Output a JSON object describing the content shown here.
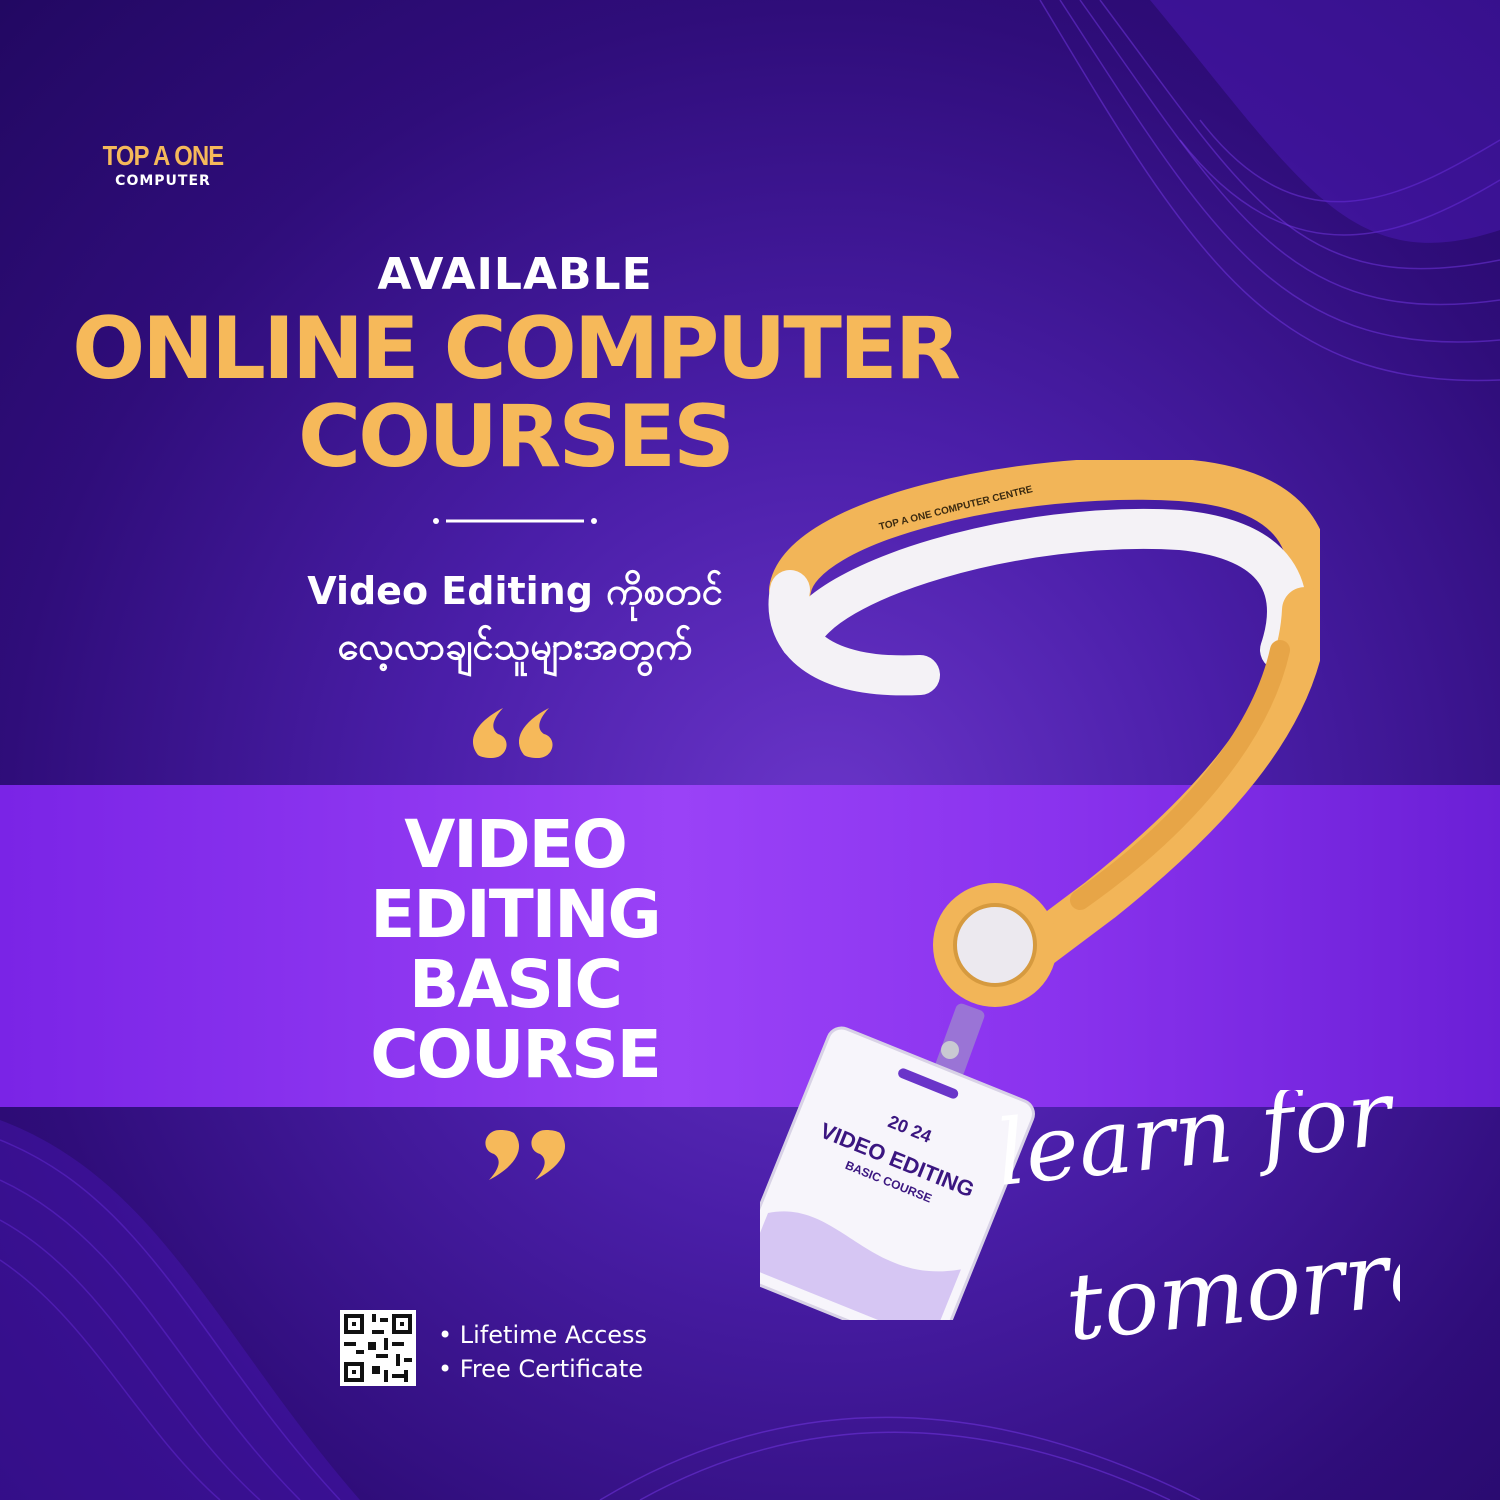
{
  "logo": {
    "name": "TOP A ONE",
    "sub": "COMPUTER"
  },
  "header": {
    "kicker": "AVAILABLE",
    "headline_lines": [
      "ONLINE COMPUTER",
      "COURSES"
    ]
  },
  "myanmar_lines": [
    "Video Editing ကိုစတင်",
    "လေ့လာချင်သူများအတွက်"
  ],
  "course_lines": [
    "VIDEO",
    "EDITING",
    "BASIC",
    "COURSE"
  ],
  "benefits": [
    "• Lifetime Access",
    "• Free Certificate"
  ],
  "script_lines": [
    "learn for",
    "tomorrow"
  ],
  "lanyard": {
    "strap_text": "TOP A ONE COMPUTER CENTRE",
    "badge_year": "20 24",
    "badge_title": "VIDEO EDITING",
    "badge_subtitle": "BASIC COURSE"
  },
  "colors": {
    "accent": "#f6b95a",
    "background": "#2f0d7a",
    "band": "#8a33ee"
  }
}
